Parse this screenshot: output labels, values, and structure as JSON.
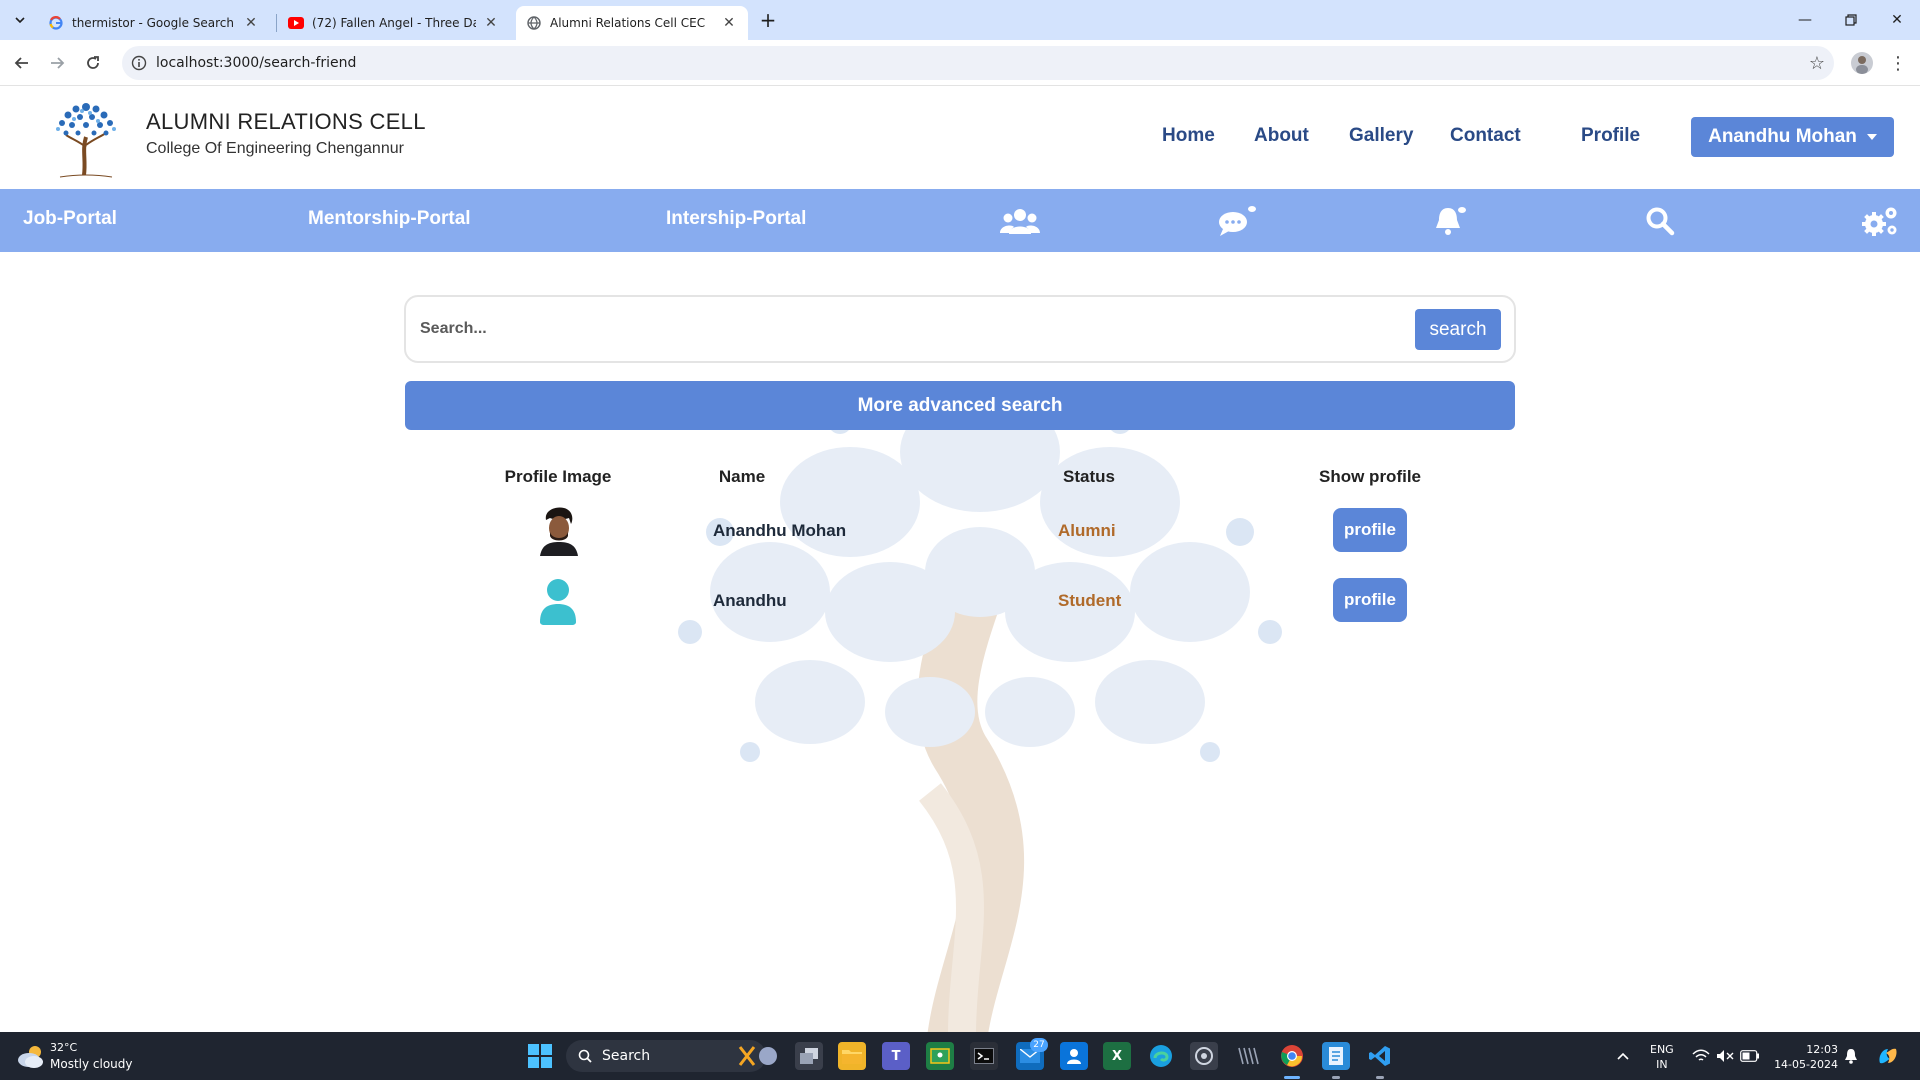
{
  "browser": {
    "tabs": [
      {
        "title": "thermistor - Google Search",
        "favicon": "google-icon",
        "active": false
      },
      {
        "title": "(72) Fallen Angel - Three Days Grace",
        "favicon": "youtube-icon",
        "active": false
      },
      {
        "title": "Alumni Relations Cell CEC",
        "favicon": "globe-icon",
        "active": true
      }
    ],
    "url": "localhost:3000/search-friend"
  },
  "site": {
    "title": "ALUMNI RELATIONS CELL",
    "subtitle": "College Of Engineering Chengannur",
    "nav": {
      "home": "Home",
      "about": "About",
      "gallery": "Gallery",
      "contact": "Contact",
      "profile": "Profile"
    },
    "user_menu_label": "Anandhu Mohan"
  },
  "subnav": {
    "job_portal": "Job-Portal",
    "mentorship_portal": "Mentorship-Portal",
    "internship_portal": "Intership-Portal",
    "icons": [
      "users-icon",
      "chat-icon",
      "bell-icon",
      "search-icon",
      "settings-icon"
    ]
  },
  "search": {
    "placeholder": "Search...",
    "button_label": "search",
    "advanced_label": "More advanced search"
  },
  "results": {
    "headers": {
      "image": "Profile Image",
      "name": "Name",
      "status": "Status",
      "show_profile": "Show profile"
    },
    "rows": [
      {
        "name": "Anandhu Mohan",
        "status": "Alumni",
        "button": "profile",
        "avatar": "photo"
      },
      {
        "name": "Anandhu",
        "status": "Student",
        "button": "profile",
        "avatar": "default-user-icon"
      }
    ]
  },
  "taskbar": {
    "weather_temp": "32°C",
    "weather_desc": "Mostly cloudy",
    "search_label": "Search",
    "mail_badge": "27",
    "lang_top": "ENG",
    "lang_bottom": "IN",
    "time": "12:03",
    "date": "14-05-2024"
  },
  "colors": {
    "accent": "#5b86d8",
    "subnav": "#88acef",
    "nav_text": "#2a4a86",
    "status_text": "#b06a2a"
  }
}
